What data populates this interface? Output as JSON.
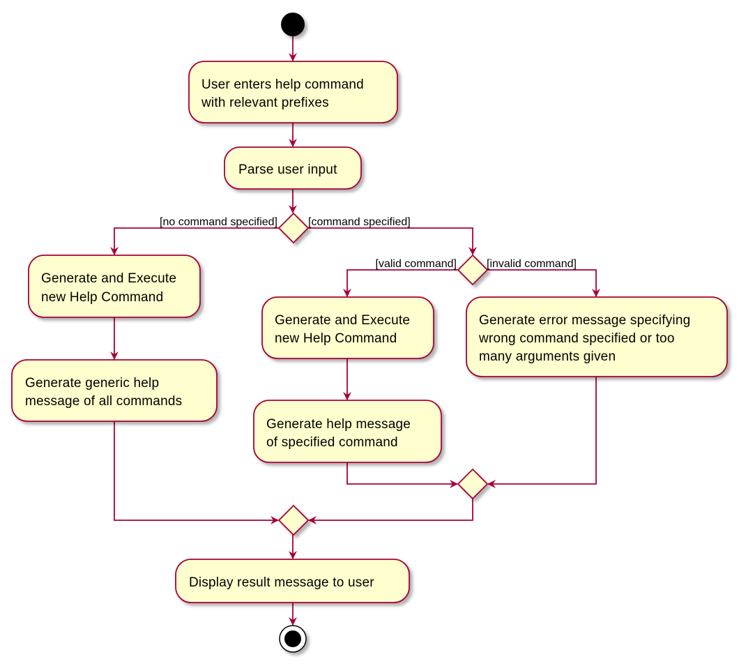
{
  "colors": {
    "node_fill": "#FEFECE",
    "border": "#A80036",
    "start_end": "#000000"
  },
  "nodes": {
    "user_enters": [
      "User enters help command",
      "with relevant prefixes"
    ],
    "parse": [
      "Parse user input"
    ],
    "gen_exec_left": [
      "Generate and Execute",
      "new Help Command"
    ],
    "generic_help": [
      "Generate generic help",
      "message of all commands"
    ],
    "gen_exec_mid": [
      "Generate and Execute",
      "new Help Command"
    ],
    "specified_help": [
      "Generate help message",
      "of specified command"
    ],
    "error_msg": [
      "Generate error message specifying",
      "wrong command specified or too",
      "many arguments given"
    ],
    "display": [
      "Display result message to user"
    ]
  },
  "guards": {
    "no_command": "[no command specified]",
    "command": "[command specified]",
    "valid": "[valid command]",
    "invalid": "[invalid command]"
  }
}
